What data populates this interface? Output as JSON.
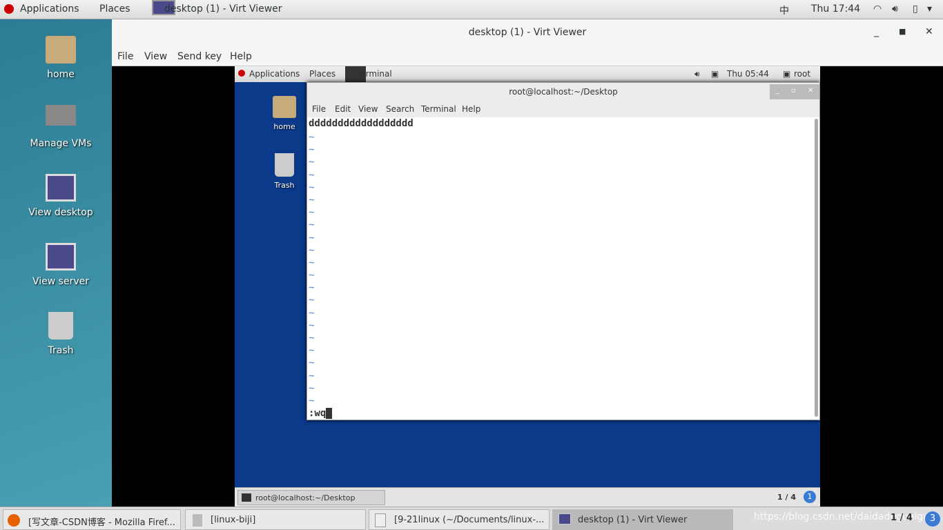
{
  "topbar": {
    "applications": "Applications",
    "places": "Places",
    "window": "desktop (1) - Virt Viewer",
    "input_method": "中",
    "clock": "Thu 17:44"
  },
  "desktop": {
    "icons": [
      "home",
      "Manage VMs",
      "View desktop",
      "View server",
      "Trash"
    ]
  },
  "viewer": {
    "title": "desktop (1) - Virt Viewer",
    "menu": [
      "File",
      "View",
      "Send key",
      "Help"
    ]
  },
  "guest": {
    "topbar": {
      "applications": "Applications",
      "places": "Places",
      "window": "Terminal",
      "clock": "Thu 05:44",
      "user": "root"
    },
    "icons": [
      "home",
      "Trash"
    ],
    "terminal": {
      "title": "root@localhost:~/Desktop",
      "menu": [
        "File",
        "Edit",
        "View",
        "Search",
        "Terminal",
        "Help"
      ],
      "line1": "dddddddddddddddddd",
      "tilde": "~",
      "command": ":wq"
    },
    "taskbar": {
      "item": "root@localhost:~/Desktop",
      "pager": "1 / 4"
    }
  },
  "taskbar": {
    "items": [
      "[写文章-CSDN博客 - Mozilla Firef...",
      "[linux-biji]",
      "[9-21linux (~/Documents/linux-...",
      "desktop (1) - Virt Viewer"
    ],
    "watermark": "https://blog.csdn.net/daidadeguaiguai",
    "pager": "1 / 4"
  },
  "colors": {
    "desktop": "#3a8a9e",
    "guest_desktop": "#0c3a8b"
  }
}
